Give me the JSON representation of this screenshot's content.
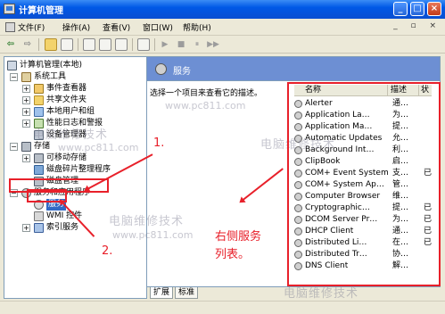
{
  "window": {
    "title": "计算机管理",
    "minimize_label": "_",
    "maximize_label": "□",
    "close_label": "×"
  },
  "menu": {
    "items": [
      {
        "label": "文件(F)"
      },
      {
        "label": "操作(A)"
      },
      {
        "label": "查看(V)"
      },
      {
        "label": "窗口(W)"
      },
      {
        "label": "帮助(H)"
      }
    ],
    "mdi_controls": "_ ▫ ×"
  },
  "toolbar": {
    "back": "⇦",
    "forward": "⇨",
    "play": "▶",
    "pause": "⏸",
    "stop": "■",
    "step": "▶▶"
  },
  "tree": {
    "root": "计算机管理(本地)",
    "items": [
      {
        "label": "系统工具"
      },
      {
        "label": "事件查看器"
      },
      {
        "label": "共享文件夹"
      },
      {
        "label": "本地用户和组"
      },
      {
        "label": "性能日志和警报"
      },
      {
        "label": "设备管理器"
      },
      {
        "label": "存储"
      },
      {
        "label": "可移动存储"
      },
      {
        "label": "磁盘碎片整理程序"
      },
      {
        "label": "磁盘管理"
      },
      {
        "label": "服务和应用程序"
      },
      {
        "label": "服务"
      },
      {
        "label": "WMI 控件"
      },
      {
        "label": "索引服务"
      }
    ],
    "expander_minus": "−",
    "expander_plus": "+"
  },
  "panel": {
    "title": "服务",
    "description": "选择一个项目来查看它的描述。"
  },
  "services": {
    "columns": [
      "名称",
      "描述",
      "状"
    ],
    "rows": [
      {
        "name": "Alerter",
        "desc": "通…",
        "status": ""
      },
      {
        "name": "Application La…",
        "desc": "为…",
        "status": ""
      },
      {
        "name": "Application Ma…",
        "desc": "提…",
        "status": ""
      },
      {
        "name": "Automatic Updates",
        "desc": "允…",
        "status": ""
      },
      {
        "name": "Background Int…",
        "desc": "利…",
        "status": ""
      },
      {
        "name": "ClipBook",
        "desc": "启…",
        "status": ""
      },
      {
        "name": "COM+ Event System",
        "desc": "支…",
        "status": "已"
      },
      {
        "name": "COM+ System Ap…",
        "desc": "管…",
        "status": ""
      },
      {
        "name": "Computer Browser",
        "desc": "维…",
        "status": ""
      },
      {
        "name": "Cryptographic…",
        "desc": "提…",
        "status": "已"
      },
      {
        "name": "DCOM Server Pr…",
        "desc": "为…",
        "status": "已"
      },
      {
        "name": "DHCP Client",
        "desc": "通…",
        "status": "已"
      },
      {
        "name": "Distributed Li…",
        "desc": "在…",
        "status": "已"
      },
      {
        "name": "Distributed Tr…",
        "desc": "协…",
        "status": ""
      },
      {
        "name": "DNS Client",
        "desc": "解…",
        "status": ""
      }
    ]
  },
  "tabs": [
    {
      "label": "扩展"
    },
    {
      "label": "标准"
    }
  ],
  "annotations": {
    "step1": "1.",
    "step2": "2.",
    "right_list_line1": "右侧服务",
    "right_list_line2": "列表。"
  },
  "watermarks": {
    "brand": "电脑维修技术",
    "url": "www.pc811.com"
  },
  "colors": {
    "title_bar": "#0a4fd1",
    "panel_header": "#6d8fd3",
    "annotation_red": "#e8202a",
    "selection": "#316ac5"
  }
}
